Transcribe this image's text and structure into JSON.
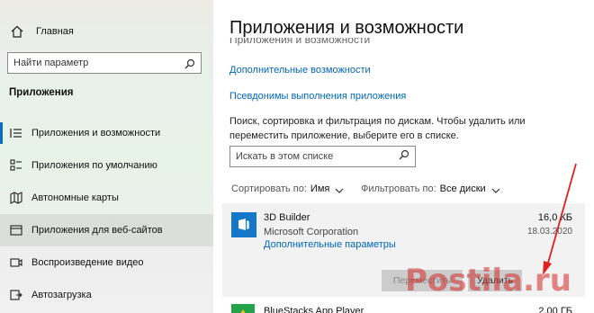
{
  "sidebar": {
    "home_label": "Главная",
    "search_placeholder": "Найти параметр",
    "section_title": "Приложения",
    "items": [
      {
        "label": "Приложения и возможности",
        "icon": "list-icon",
        "active": true
      },
      {
        "label": "Приложения по умолчанию",
        "icon": "default-apps-icon"
      },
      {
        "label": "Автономные карты",
        "icon": "map-icon"
      },
      {
        "label": "Приложения для веб-сайтов",
        "icon": "web-apps-icon"
      },
      {
        "label": "Воспроизведение видео",
        "icon": "video-icon"
      },
      {
        "label": "Автозагрузка",
        "icon": "startup-icon"
      }
    ]
  },
  "main": {
    "title": "Приложения и возможности",
    "faded_heading": "Приложения и возможности",
    "links": [
      "Дополнительные возможности",
      "Псевдонимы выполнения приложения"
    ],
    "description": "Поиск, сортировка и фильтрация по дискам. Чтобы удалить или переместить приложение, выберите его в списке.",
    "list_search_placeholder": "Искать в этом списке",
    "sort_label": "Сортировать по:",
    "sort_value": "Имя",
    "filter_label": "Фильтровать по:",
    "filter_value": "Все диски",
    "apps": [
      {
        "name": "3D Builder",
        "publisher": "Microsoft Corporation",
        "advanced_link": "Дополнительные параметры",
        "size": "16,0 КБ",
        "date": "18.03.2020",
        "move_label": "Переместить",
        "uninstall_label": "Удалить"
      },
      {
        "name": "BlueStacks App Player",
        "size": "2,00 ГБ"
      }
    ]
  },
  "watermark": "Postila.ru",
  "colors": {
    "accent": "#0a6dc1",
    "link": "#0067b8",
    "arrow": "#e02020",
    "app_icon": "#1577c9"
  }
}
